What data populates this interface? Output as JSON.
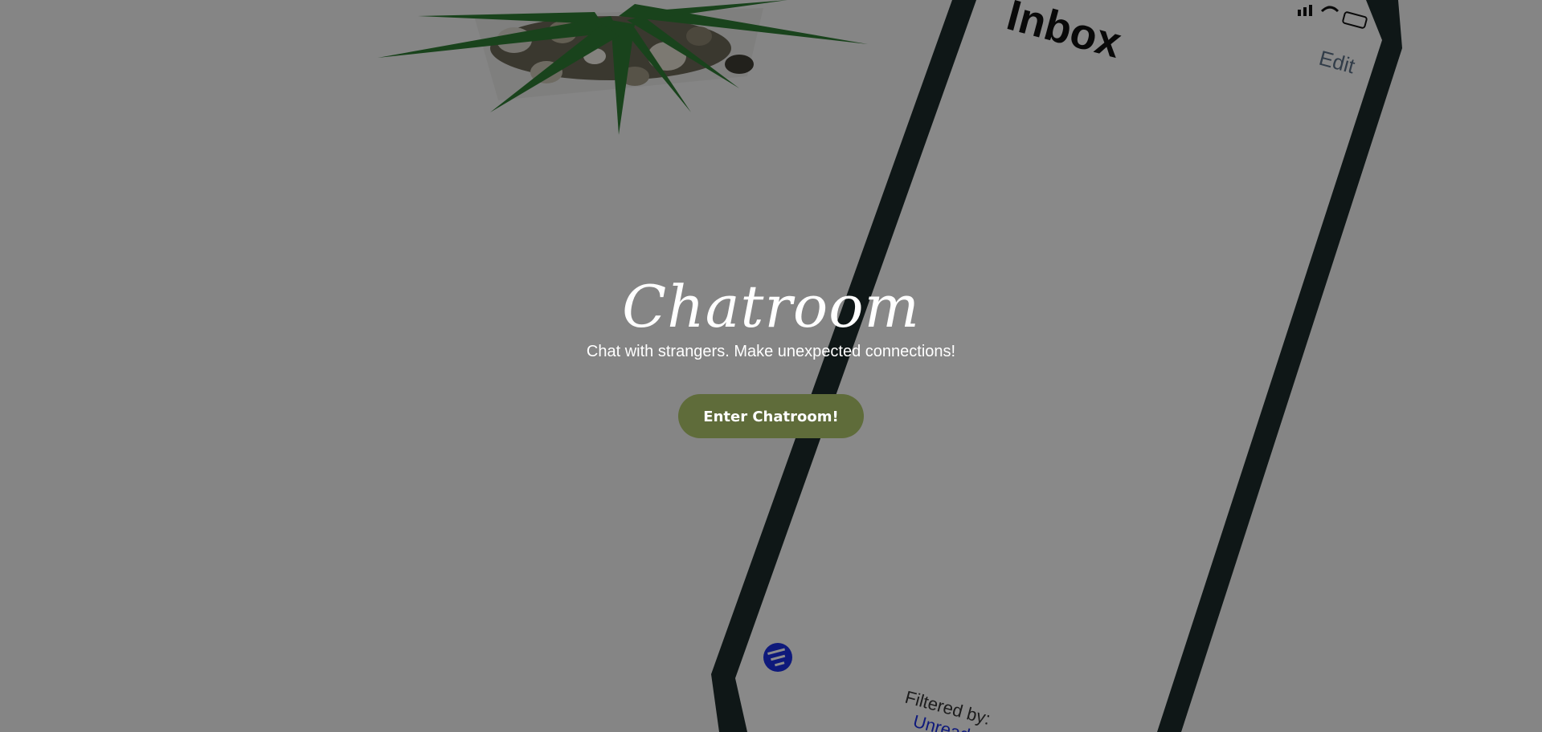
{
  "background": {
    "phone_screen": {
      "title": "Inbox",
      "edit_label": "Edit",
      "filter_label": "Filtered by:",
      "filter_value": "Unread"
    },
    "colors": {
      "overlay": "#000000",
      "phone_frame": "#1d2a2a",
      "phone_screen": "#fafafa",
      "plant_leaf": "#2f7a33",
      "filter_icon": "#1b2ee0"
    }
  },
  "hero": {
    "title": "Chatroom",
    "subtitle": "Chat with strangers. Make unexpected connections!",
    "enter_button_label": "Enter Chatroom!"
  },
  "colors": {
    "button_bg": "#5f6c3a",
    "text": "#ffffff"
  }
}
